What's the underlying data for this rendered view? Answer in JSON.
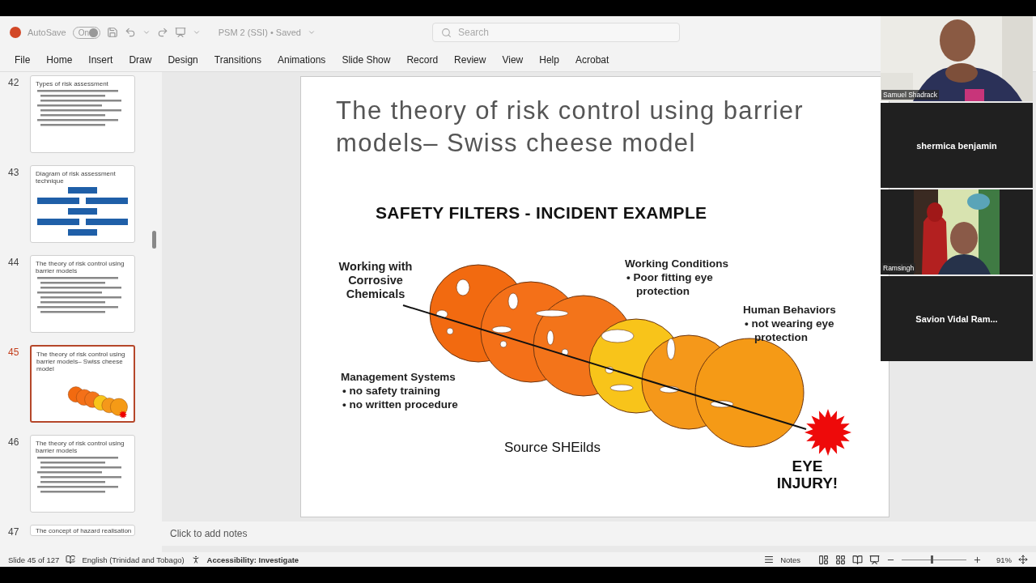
{
  "window": {
    "autosave_label": "AutoSave",
    "autosave_toggle": {
      "label": "On",
      "on": true
    },
    "document_title": "PSM 2 (SSI) • Saved"
  },
  "search": {
    "placeholder": "Search"
  },
  "ribbon_tabs": [
    "File",
    "Home",
    "Insert",
    "Draw",
    "Design",
    "Transitions",
    "Animations",
    "Slide Show",
    "Record",
    "Review",
    "View",
    "Help",
    "Acrobat"
  ],
  "slide_thumbnails": [
    {
      "number": "42",
      "title": "Types of risk assessment",
      "kind": "bullets",
      "selected": false
    },
    {
      "number": "43",
      "title": "Diagram of risk assessment technique",
      "kind": "flowchart",
      "selected": false
    },
    {
      "number": "44",
      "title": "The theory of risk control using barrier models",
      "kind": "bullets",
      "selected": false
    },
    {
      "number": "45",
      "title": "The theory of risk control using barrier models– Swiss cheese model",
      "kind": "cheese",
      "selected": true
    },
    {
      "number": "46",
      "title": "The theory of risk control using barrier models",
      "kind": "bullets",
      "selected": false
    },
    {
      "number": "47",
      "title": "The concept of hazard realisation",
      "kind": "cut",
      "selected": false
    }
  ],
  "slide": {
    "title": "The theory of risk control using barrier models– Swiss cheese model",
    "heading": "SAFETY FILTERS - INCIDENT EXAMPLE",
    "hazard": "Working with Corrosive Chemicals",
    "factors": [
      {
        "title": "Working Conditions",
        "bullets": [
          "• Poor fitting eye protection"
        ]
      },
      {
        "title": "Human Behaviors",
        "bullets": [
          "• not wearing eye protection"
        ]
      },
      {
        "title": "Management Systems",
        "bullets": [
          "• no safety training",
          "• no written procedure"
        ]
      }
    ],
    "source": "Source SHEilds",
    "outcome": "EYE INJURY!"
  },
  "notes_placeholder": "Click to add notes",
  "status_bar": {
    "slide_position": "Slide 45 of 127",
    "language": "English (Trinidad and Tobago)",
    "accessibility": "Accessibility: Investigate",
    "notes": "Notes",
    "zoom": "91%",
    "level": 0.45
  },
  "participants": [
    {
      "name": "Samuel Shadrack",
      "kind": "video"
    },
    {
      "name": "shermica benjamin",
      "kind": "name"
    },
    {
      "name": "Ramsingh",
      "kind": "video"
    },
    {
      "name": "Savion Vidal Ram...",
      "kind": "name"
    }
  ]
}
